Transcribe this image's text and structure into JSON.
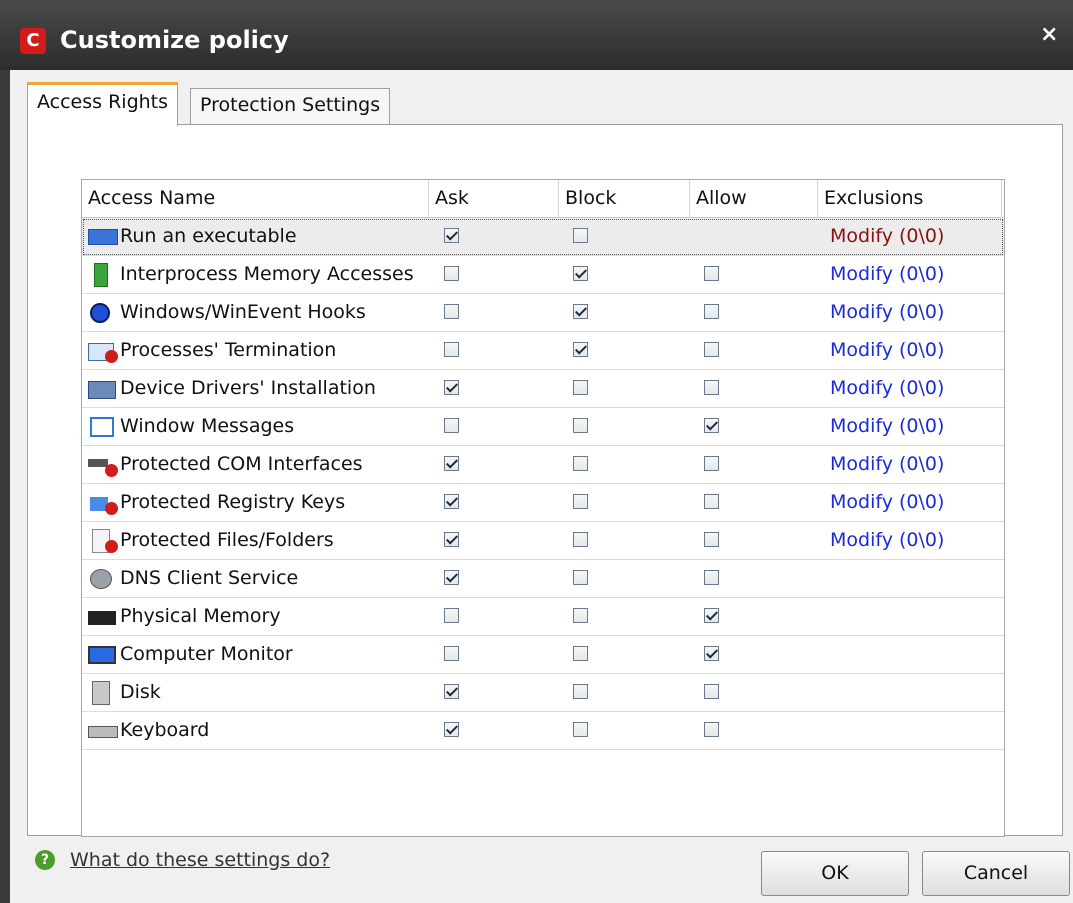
{
  "window": {
    "title": "Customize policy",
    "logo_letter": "C",
    "close_glyph": "×"
  },
  "tabs": [
    {
      "label": "Access Rights",
      "active": true
    },
    {
      "label": "Protection Settings",
      "active": false
    }
  ],
  "table": {
    "columns": [
      "Access Name",
      "Ask",
      "Block",
      "Allow",
      "Exclusions"
    ],
    "rows": [
      {
        "name": "Run an executable",
        "icon": "executable-icon",
        "ask": true,
        "block": false,
        "allow": null,
        "exclusions": "Modify (0\\0)",
        "selected": true
      },
      {
        "name": "Interprocess Memory Accesses",
        "icon": "memory-chip-icon",
        "ask": false,
        "block": true,
        "allow": false,
        "exclusions": "Modify (0\\0)"
      },
      {
        "name": "Windows/WinEvent Hooks",
        "icon": "hook-icon",
        "ask": false,
        "block": true,
        "allow": false,
        "exclusions": "Modify (0\\0)"
      },
      {
        "name": "Processes' Termination",
        "icon": "process-termination-icon",
        "ask": false,
        "block": true,
        "allow": false,
        "exclusions": "Modify (0\\0)"
      },
      {
        "name": "Device Drivers' Installation",
        "icon": "device-driver-icon",
        "ask": true,
        "block": false,
        "allow": false,
        "exclusions": "Modify (0\\0)"
      },
      {
        "name": "Window Messages",
        "icon": "window-messages-icon",
        "ask": false,
        "block": false,
        "allow": true,
        "exclusions": "Modify (0\\0)"
      },
      {
        "name": "Protected COM Interfaces",
        "icon": "com-interface-icon",
        "ask": true,
        "block": false,
        "allow": false,
        "exclusions": "Modify (0\\0)"
      },
      {
        "name": "Protected Registry Keys",
        "icon": "registry-keys-icon",
        "ask": true,
        "block": false,
        "allow": false,
        "exclusions": "Modify (0\\0)"
      },
      {
        "name": "Protected Files/Folders",
        "icon": "files-folders-icon",
        "ask": true,
        "block": false,
        "allow": false,
        "exclusions": "Modify (0\\0)"
      },
      {
        "name": "DNS Client Service",
        "icon": "dns-client-icon",
        "ask": true,
        "block": false,
        "allow": false,
        "exclusions": ""
      },
      {
        "name": "Physical Memory",
        "icon": "physical-memory-icon",
        "ask": false,
        "block": false,
        "allow": true,
        "exclusions": ""
      },
      {
        "name": "Computer Monitor",
        "icon": "monitor-icon",
        "ask": false,
        "block": false,
        "allow": true,
        "exclusions": ""
      },
      {
        "name": "Disk",
        "icon": "disk-icon",
        "ask": true,
        "block": false,
        "allow": false,
        "exclusions": ""
      },
      {
        "name": "Keyboard",
        "icon": "keyboard-icon",
        "ask": true,
        "block": false,
        "allow": false,
        "exclusions": ""
      }
    ]
  },
  "footer": {
    "help_link": "What do these settings do?",
    "ok_label": "OK",
    "cancel_label": "Cancel"
  },
  "colors": {
    "link": "#1a2bd6",
    "selected_link": "#8b1010",
    "tab_accent": "#f2a33a",
    "brand": "#d21b1b"
  }
}
